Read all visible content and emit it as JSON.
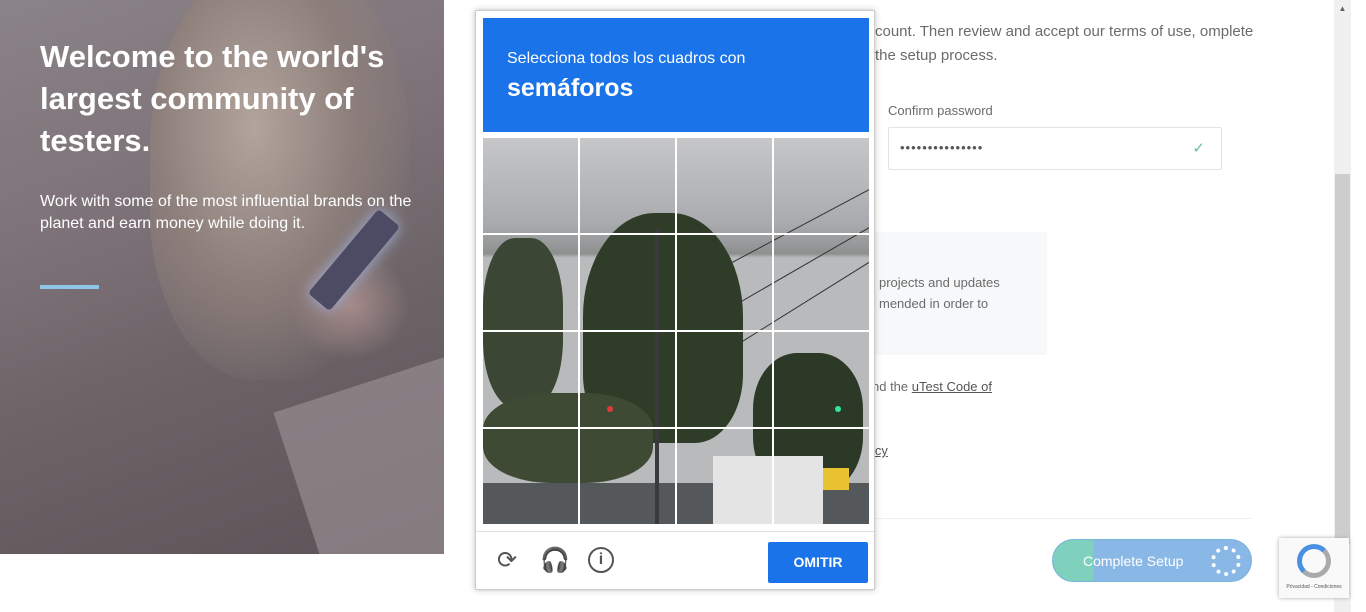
{
  "hero": {
    "title": "Welcome to the world's largest community of testers.",
    "subtitle": "Work with some of the most influential brands on the planet and earn money while doing it."
  },
  "form": {
    "intro_text": "count. Then review and accept our terms of use, omplete the setup process.",
    "confirm_password_label": "Confirm password",
    "confirm_password_value": "•••••••••••••••",
    "notice_text": "projects and updates mended in order to",
    "code_prefix": "nd the ",
    "code_link": "uTest Code of",
    "policy_fragment": "icy",
    "complete_setup_label": "Complete Setup"
  },
  "captcha": {
    "instruction": "Selecciona todos los cuadros con",
    "keyword": "semáforos",
    "skip_label": "OMITIR",
    "icons": [
      "reload-icon",
      "headphones-icon",
      "info-icon"
    ]
  },
  "badge": {
    "text": "Privacidad - Condiciones"
  },
  "colors": {
    "captcha_blue": "#1a73e8",
    "hero_accent": "#8fc6e6",
    "check_green": "#5cc2a2"
  }
}
